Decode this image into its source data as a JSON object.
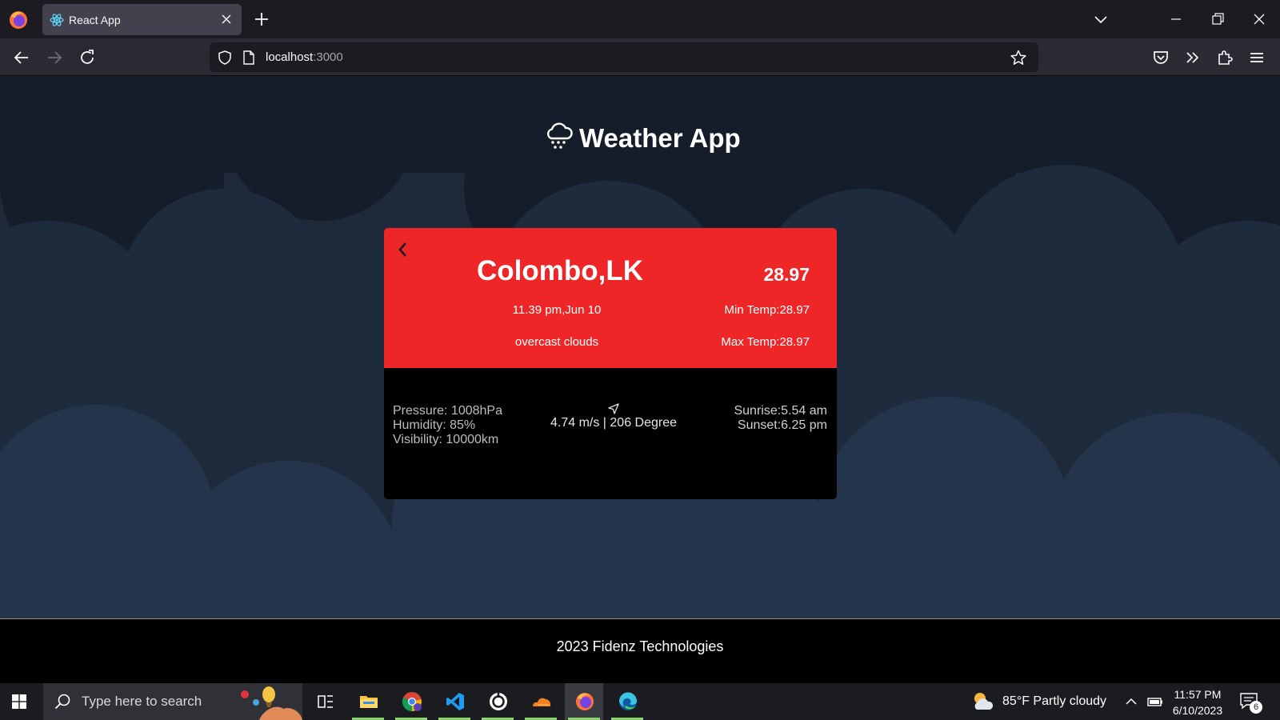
{
  "browser": {
    "tab_title": "React App",
    "url_host": "localhost",
    "url_port": ":3000"
  },
  "app": {
    "title": "Weather App"
  },
  "weather": {
    "city": "Colombo,LK",
    "datetime": "11.39 pm,Jun 10",
    "description": "overcast clouds",
    "temp": "28.97",
    "min_temp": "Min Temp:28.97",
    "max_temp": "Max Temp:28.97",
    "pressure": "Pressure: 1008hPa",
    "humidity": "Humidity: 85%",
    "visibility": "Visibility: 10000km",
    "wind": "4.74 m/s | 206 Degree",
    "sunrise": "Sunrise:5.54 am",
    "sunset": "Sunset:6.25 pm"
  },
  "footer": {
    "text": "2023 Fidenz Technologies"
  },
  "taskbar": {
    "search_placeholder": "Type here to search",
    "weather": "85°F  Partly cloudy",
    "time": "11:57 PM",
    "date": "6/10/2023",
    "notification_count": "6"
  },
  "colors": {
    "card_accent": "#ee2628",
    "card_body": "#000000",
    "page_bg": "#1a2534",
    "browser_chrome": "#2b2a33"
  }
}
